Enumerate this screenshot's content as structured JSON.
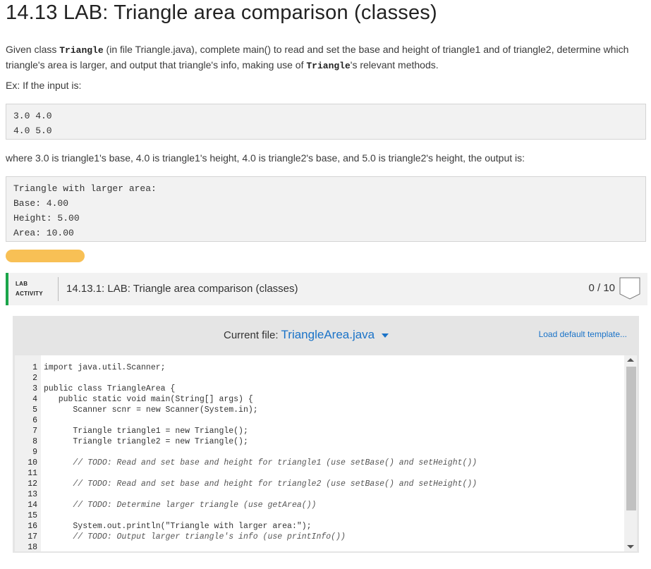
{
  "page": {
    "title": "14.13 LAB: Triangle area comparison (classes)"
  },
  "intro": {
    "part1": "Given class ",
    "code1": "Triangle",
    "part2": " (in file Triangle.java), complete main() to read and set the base and height of triangle1 and of triangle2, determine which triangle's area is larger, and output that triangle's info, making use of ",
    "code2": "Triangle",
    "part3": "'s relevant methods."
  },
  "example": {
    "lead": "Ex: If the input is:",
    "input": "3.0 4.0\n4.0 5.0",
    "explanation": "where 3.0 is triangle1's base, 4.0 is triangle1's height, 4.0 is triangle2's base, and 5.0 is triangle2's height, the output is:",
    "output": "Triangle with larger area:\nBase: 4.00\nHeight: 5.00\nArea: 10.00"
  },
  "lab": {
    "tag_line1": "LAB",
    "tag_line2": "ACTIVITY",
    "title": "14.13.1: LAB: Triangle area comparison (classes)",
    "score": "0 / 10",
    "accent_color": "#1aa54a"
  },
  "editor": {
    "current_file_label": "Current file:",
    "file_name": "TriangleArea.java",
    "load_default": "Load default template...",
    "link_color": "#1a73c8",
    "lines": [
      {
        "n": "1",
        "text": "import java.util.Scanner;",
        "comment": false
      },
      {
        "n": "2",
        "text": "",
        "comment": false
      },
      {
        "n": "3",
        "text": "public class TriangleArea {",
        "comment": false
      },
      {
        "n": "4",
        "text": "   public static void main(String[] args) {",
        "comment": false
      },
      {
        "n": "5",
        "text": "      Scanner scnr = new Scanner(System.in);",
        "comment": false
      },
      {
        "n": "6",
        "text": "",
        "comment": false
      },
      {
        "n": "7",
        "text": "      Triangle triangle1 = new Triangle();",
        "comment": false
      },
      {
        "n": "8",
        "text": "      Triangle triangle2 = new Triangle();",
        "comment": false
      },
      {
        "n": "9",
        "text": "",
        "comment": false
      },
      {
        "n": "10",
        "text": "      // TODO: Read and set base and height for triangle1 (use setBase() and setHeight())",
        "comment": true
      },
      {
        "n": "11",
        "text": "",
        "comment": false
      },
      {
        "n": "12",
        "text": "      // TODO: Read and set base and height for triangle2 (use setBase() and setHeight())",
        "comment": true
      },
      {
        "n": "13",
        "text": "",
        "comment": false
      },
      {
        "n": "14",
        "text": "      // TODO: Determine larger triangle (use getArea())",
        "comment": true
      },
      {
        "n": "15",
        "text": "",
        "comment": false
      },
      {
        "n": "16",
        "text": "      System.out.println(\"Triangle with larger area:\");",
        "comment": false
      },
      {
        "n": "17",
        "text": "      // TODO: Output larger triangle's info (use printInfo())",
        "comment": true
      },
      {
        "n": "18",
        "text": "",
        "comment": false
      }
    ]
  }
}
